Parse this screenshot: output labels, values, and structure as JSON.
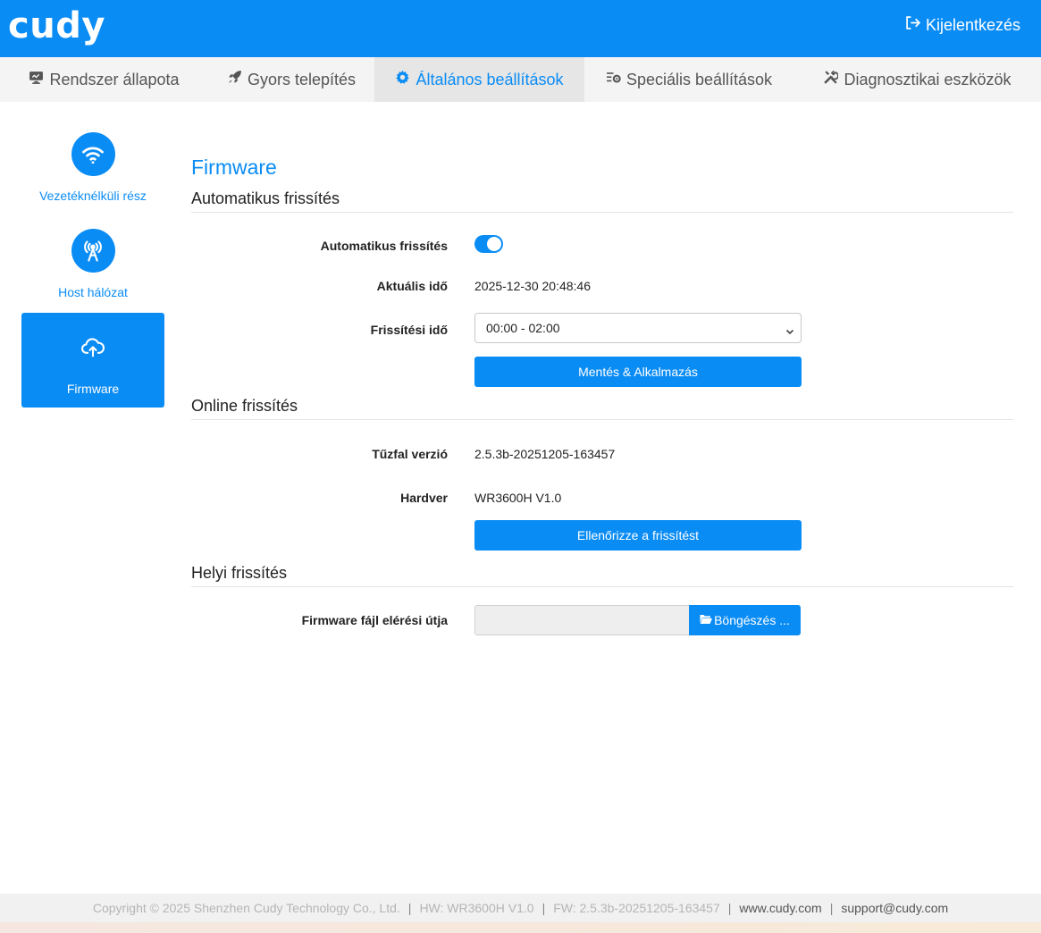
{
  "header": {
    "logo": "cudy",
    "logout_label": "Kijelentkezés"
  },
  "tabs": [
    {
      "label": "Rendszer állapota",
      "icon": "monitor-icon"
    },
    {
      "label": "Gyors telepítés",
      "icon": "rocket-icon"
    },
    {
      "label": "Általános beállítások",
      "icon": "gear-icon",
      "active": true
    },
    {
      "label": "Speciális beállítások",
      "icon": "sliders-gear-icon"
    },
    {
      "label": "Diagnosztikai eszközök",
      "icon": "tools-icon"
    }
  ],
  "sidebar": {
    "items": [
      {
        "label": "Vezetéknélküli rész",
        "icon": "wifi-icon"
      },
      {
        "label": "Host hálózat",
        "icon": "antenna-icon"
      },
      {
        "label": "Firmware",
        "icon": "cloud-upload-icon",
        "active": true
      }
    ]
  },
  "main": {
    "title": "Firmware",
    "auto_section": {
      "title": "Automatikus frissítés",
      "toggle_label": "Automatikus frissítés",
      "toggle_on": true,
      "current_time_label": "Aktuális idő",
      "current_time_value": "2025-12-30 20:48:46",
      "update_time_label": "Frissítési idő",
      "update_time_value": "00:00 - 02:00",
      "save_button": "Mentés & Alkalmazás"
    },
    "online_section": {
      "title": "Online frissítés",
      "firmware_version_label": "Tűzfal verzió",
      "firmware_version_value": "2.5.3b-20251205-163457",
      "hardware_label": "Hardver",
      "hardware_value": "WR3600H V1.0",
      "check_button": "Ellenőrizze a frissítést"
    },
    "local_section": {
      "title": "Helyi frissítés",
      "file_path_label": "Firmware fájl elérési útja",
      "file_path_value": "",
      "browse_button": "Böngészés ..."
    }
  },
  "footer": {
    "copyright": "Copyright © 2025 Shenzhen Cudy Technology Co., Ltd.",
    "hw": "HW: WR3600H V1.0",
    "fw": "FW: 2.5.3b-20251205-163457",
    "site": "www.cudy.com",
    "email": "support@cudy.com"
  },
  "colors": {
    "accent": "#0a8cf5",
    "tab_bar": "#f4f4f4",
    "active_tab": "#e6e6e6"
  }
}
